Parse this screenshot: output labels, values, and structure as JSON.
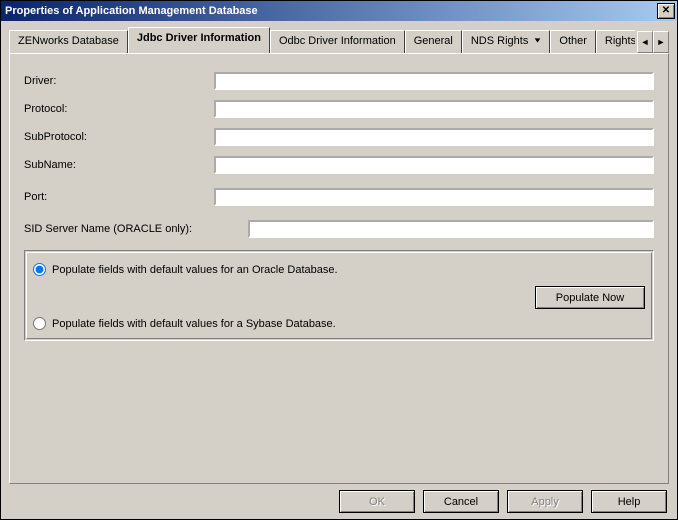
{
  "window": {
    "title": "Properties of Application Management Database",
    "close_glyph": "✕"
  },
  "tabs": {
    "items": [
      {
        "label": "ZENworks Database",
        "active": false,
        "dropdown": false
      },
      {
        "label": "Jdbc Driver Information",
        "active": true,
        "dropdown": false
      },
      {
        "label": "Odbc Driver Information",
        "active": false,
        "dropdown": false
      },
      {
        "label": "General",
        "active": false,
        "dropdown": false
      },
      {
        "label": "NDS Rights",
        "active": false,
        "dropdown": true
      },
      {
        "label": "Other",
        "active": false,
        "dropdown": false
      },
      {
        "label": "Rights to",
        "active": false,
        "dropdown": false
      }
    ],
    "nav_left": "◄",
    "nav_right": "►"
  },
  "form": {
    "driver_label": "Driver:",
    "driver_value": "",
    "protocol_label": "Protocol:",
    "protocol_value": "",
    "subprotocol_label": "SubProtocol:",
    "subprotocol_value": "",
    "subname_label": "SubName:",
    "subname_value": "",
    "port_label": "Port:",
    "port_value": "",
    "sid_label": "SID Server Name (ORACLE only):",
    "sid_value": ""
  },
  "group": {
    "radio_oracle_label": "Populate fields with default values for an Oracle Database.",
    "radio_sybase_label": "Populate fields with default values for a Sybase Database.",
    "selected": "oracle",
    "populate_button": "Populate Now"
  },
  "buttons": {
    "ok": "OK",
    "cancel": "Cancel",
    "apply": "Apply",
    "help": "Help"
  }
}
